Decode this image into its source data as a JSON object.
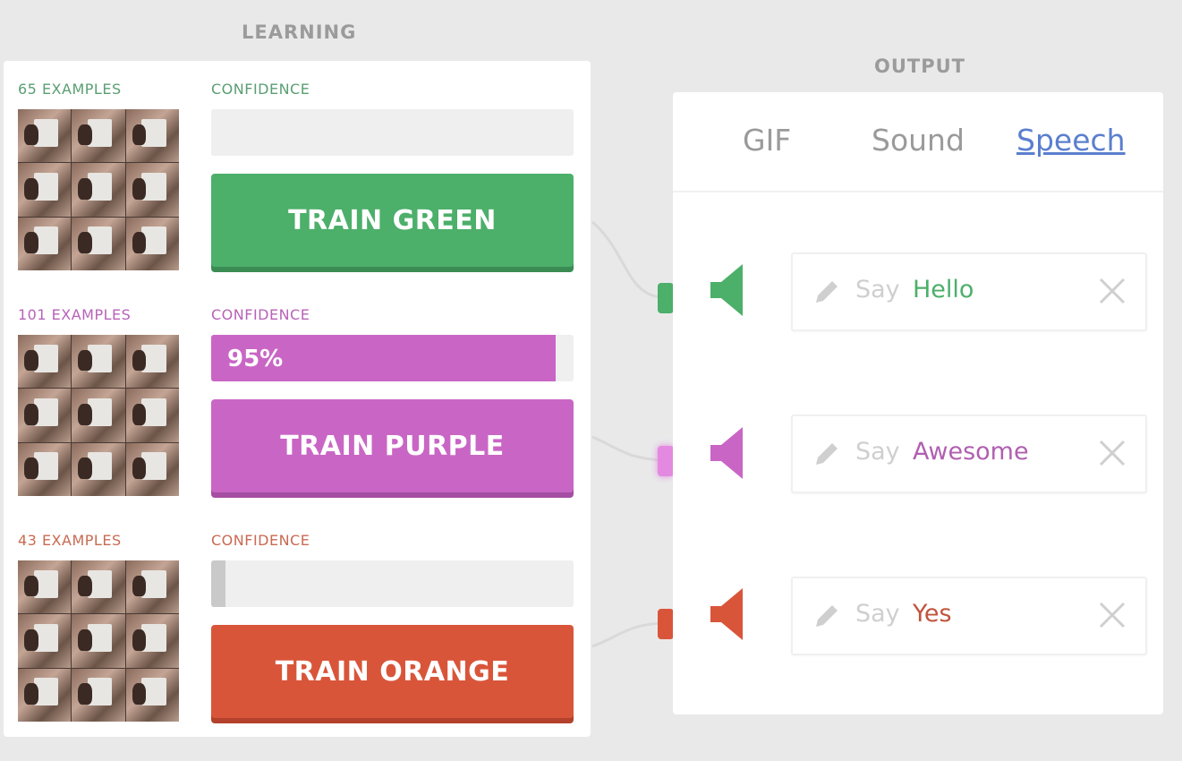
{
  "learning": {
    "label": "LEARNING",
    "classes": [
      {
        "examples": "65 EXAMPLES",
        "confidence_label": "CONFIDENCE",
        "confidence": 0,
        "confidence_text": "",
        "button": "TRAIN GREEN",
        "color": "#4caf6a"
      },
      {
        "examples": "101 EXAMPLES",
        "confidence_label": "CONFIDENCE",
        "confidence": 0.95,
        "confidence_text": "95%",
        "button": "TRAIN PURPLE",
        "color": "#c966c5"
      },
      {
        "examples": "43 EXAMPLES",
        "confidence_label": "CONFIDENCE",
        "confidence": 0.04,
        "confidence_text": "",
        "button": "TRAIN ORANGE",
        "color": "#d9553a"
      }
    ]
  },
  "output": {
    "label": "OUTPUT",
    "tabs": [
      "GIF",
      "Sound",
      "Speech"
    ],
    "active_tab": "Speech",
    "speech": [
      {
        "say": "Say",
        "value": "Hello",
        "color": "#4caf6a"
      },
      {
        "say": "Say",
        "value": "Awesome",
        "color": "#b05fb0"
      },
      {
        "say": "Say",
        "value": "Yes",
        "color": "#c0553d"
      }
    ]
  }
}
